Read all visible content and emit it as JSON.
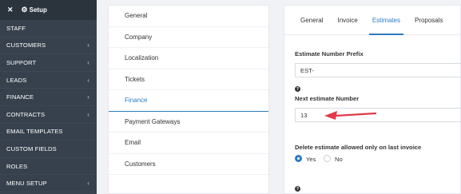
{
  "sidebar": {
    "header": {
      "close_icon": "✕",
      "title": "Setup"
    },
    "items": [
      {
        "label": "STAFF",
        "chevron": false
      },
      {
        "label": "CUSTOMERS",
        "chevron": true
      },
      {
        "label": "SUPPORT",
        "chevron": true
      },
      {
        "label": "LEADS",
        "chevron": true
      },
      {
        "label": "FINANCE",
        "chevron": true
      },
      {
        "label": "CONTRACTS",
        "chevron": true
      },
      {
        "label": "EMAIL TEMPLATES",
        "chevron": false
      },
      {
        "label": "CUSTOM FIELDS",
        "chevron": false
      },
      {
        "label": "ROLES",
        "chevron": false
      },
      {
        "label": "MENU SETUP",
        "chevron": true
      }
    ]
  },
  "settings_menu": {
    "items": [
      "General",
      "Company",
      "Localization",
      "Tickets",
      "Finance",
      "Payment Gateways",
      "Email",
      "Customers"
    ],
    "active": "Finance"
  },
  "finance": {
    "tabs": [
      "General",
      "Invoice",
      "Estimates",
      "Proposals"
    ],
    "active_tab": "Estimates",
    "prefix_label": "Estimate Number Prefix",
    "prefix_value": "EST-",
    "next_number_label": "Next estimate Number",
    "next_number_value": "13",
    "delete_label": "Delete estimate allowed only on last invoice",
    "yes_label": "Yes",
    "no_label": "No",
    "delete_selected": "Yes"
  },
  "colors": {
    "sidebar_bg": "#37414d",
    "accent": "#2b7bbf",
    "arrow": "#e3394a"
  }
}
